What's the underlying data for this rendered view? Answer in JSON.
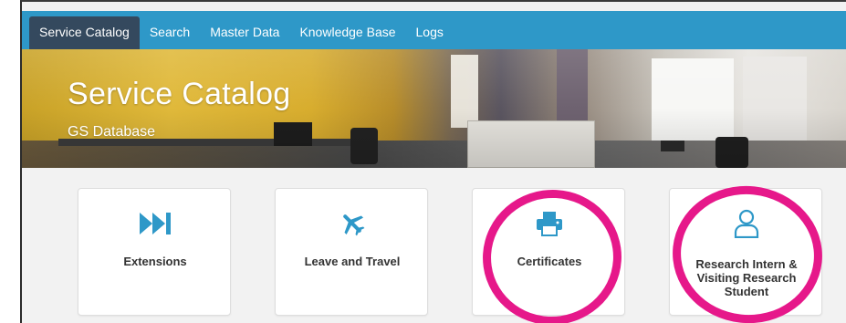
{
  "nav": {
    "items": [
      {
        "label": "Service Catalog",
        "active": true
      },
      {
        "label": "Search",
        "active": false
      },
      {
        "label": "Master Data",
        "active": false
      },
      {
        "label": "Knowledge Base",
        "active": false
      },
      {
        "label": "Logs",
        "active": false
      }
    ]
  },
  "hero": {
    "title": "Service Catalog",
    "subtitle": "GS Database"
  },
  "cards": [
    {
      "label": "Extensions",
      "icon": "fast-forward-icon",
      "highlighted": false
    },
    {
      "label": "Leave and Travel",
      "icon": "airplane-icon",
      "highlighted": false
    },
    {
      "label": "Certificates",
      "icon": "printer-icon",
      "highlighted": true
    },
    {
      "label": "Research Intern & Visiting Research Student",
      "icon": "user-icon",
      "highlighted": true
    }
  ],
  "colors": {
    "nav_bg": "#2e98c8",
    "nav_active_bg": "#34495e",
    "icon_blue": "#2e98c8",
    "highlight_pink": "#e6188a"
  }
}
